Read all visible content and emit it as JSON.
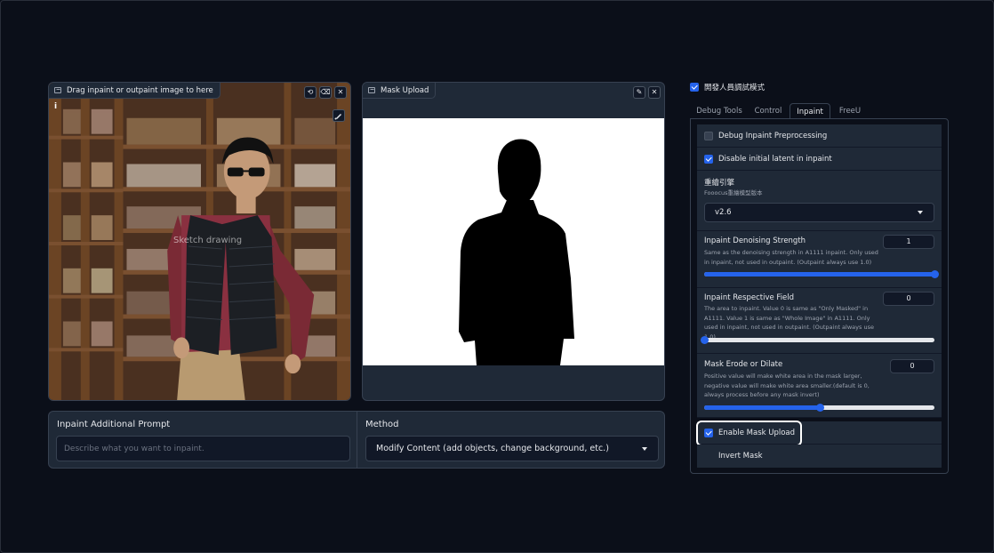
{
  "image_panel": {
    "label": "Drag inpaint or outpaint image to here",
    "watermark": "Sketch drawing",
    "info_mark": "i"
  },
  "mask_panel": {
    "label": "Mask Upload"
  },
  "prompt_panel": {
    "title": "Inpaint Additional Prompt",
    "placeholder": "Describe what you want to inpaint.",
    "value": ""
  },
  "method_panel": {
    "title": "Method",
    "selected": "Modify Content (add objects, change background, etc.)"
  },
  "developer_mode": {
    "label": "開發人員調試模式",
    "checked": true
  },
  "tabs": [
    {
      "label": "Debug Tools",
      "active": false
    },
    {
      "label": "Control",
      "active": false
    },
    {
      "label": "Inpaint",
      "active": true
    },
    {
      "label": "FreeU",
      "active": false
    }
  ],
  "inpaint_settings": {
    "debug_preprocessing": {
      "label": "Debug Inpaint Preprocessing",
      "checked": false
    },
    "disable_initial_latent": {
      "label": "Disable initial latent in inpaint",
      "checked": true
    },
    "engine": {
      "title": "重繪引擎",
      "subtitle": "Fooocus重繪模型版本",
      "selected": "v2.6"
    },
    "denoising": {
      "title": "Inpaint Denoising Strength",
      "description": "Same as the denoising strength in A1111 inpaint. Only used in inpaint, not used in outpaint. (Outpaint always use 1.0)",
      "value": "1",
      "fraction": 1.0
    },
    "respective_field": {
      "title": "Inpaint Respective Field",
      "description": "The area to inpaint. Value 0 is same as \"Only Masked\" in A1111. Value 1 is same as \"Whole Image\" in A1111. Only used in inpaint, not used in outpaint. (Outpaint always use 1.0)",
      "value": "0",
      "fraction": 0.0
    },
    "erode_dilate": {
      "title": "Mask Erode or Dilate",
      "description": "Positive value will make white area in the mask larger, negative value will make white area smaller.(default is 0, always process before any mask invert)",
      "value": "0",
      "fraction": 0.5
    },
    "enable_mask_upload": {
      "label": "Enable Mask Upload",
      "checked": true
    },
    "invert_mask": {
      "label": "Invert Mask",
      "checked": false
    }
  },
  "colors": {
    "accent": "#2563eb",
    "highlight_outline": "#ffffff",
    "panel": "#1f2937",
    "background": "#0b0f19"
  }
}
